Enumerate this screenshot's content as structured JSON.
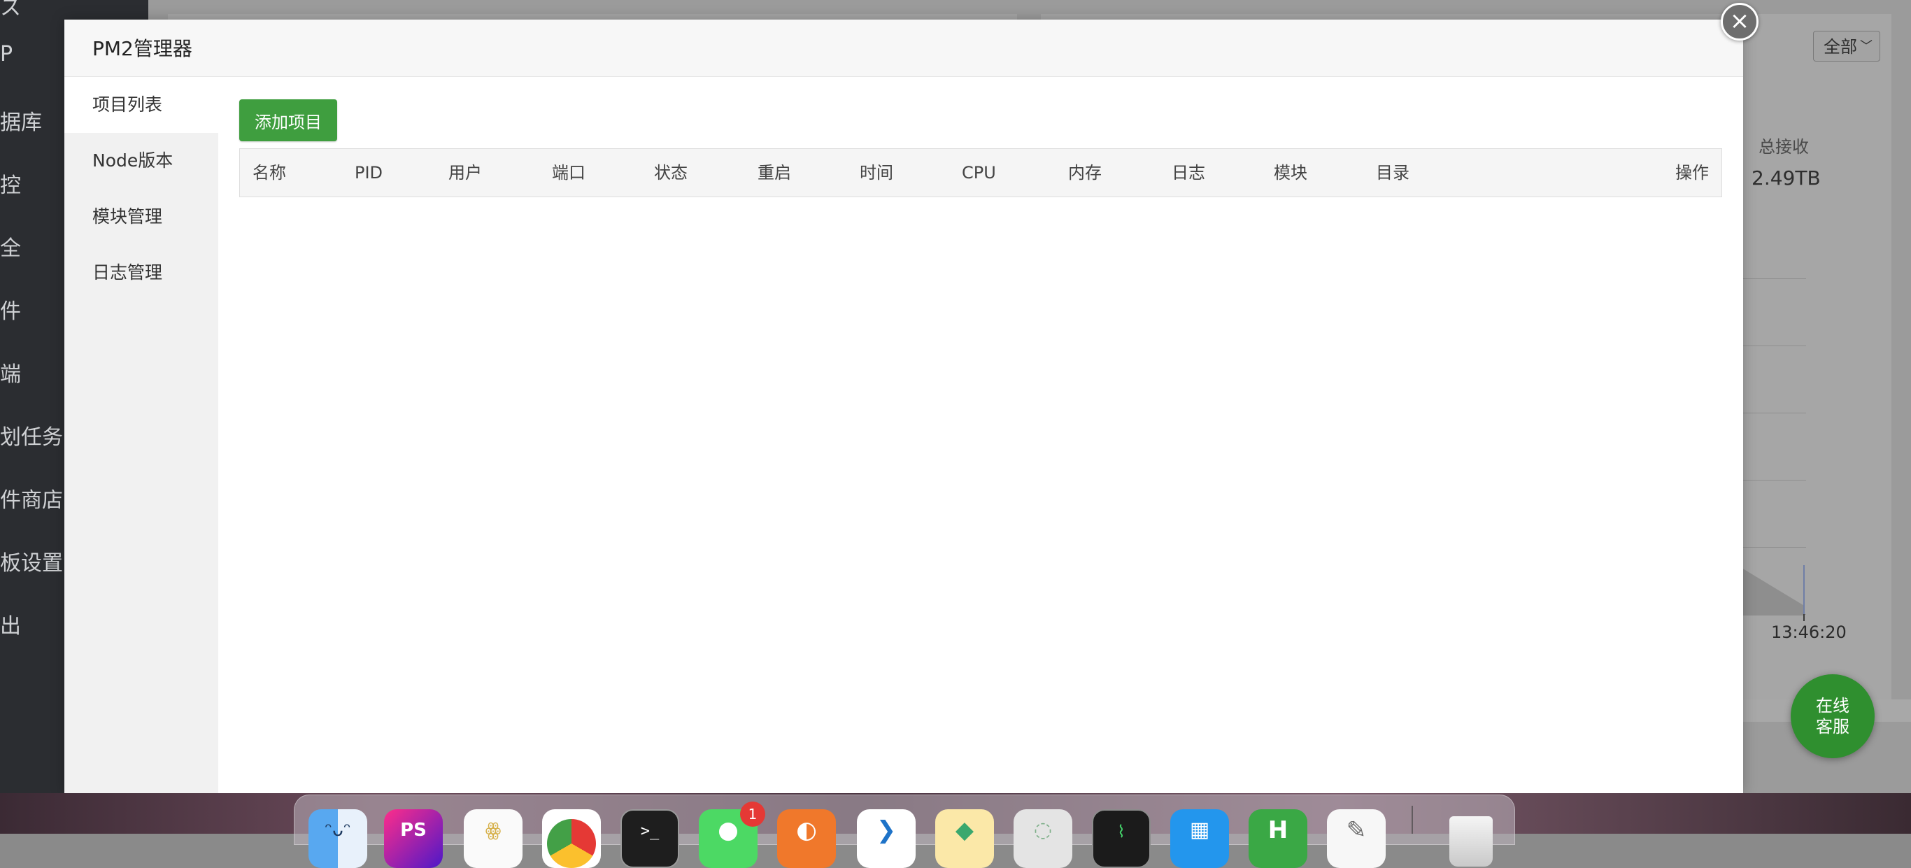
{
  "background": {
    "sidebar_items": [
      "P",
      "据库",
      "控",
      "全",
      "件",
      "端",
      "划任务",
      "件商店",
      "板设置",
      "出"
    ],
    "filter_select": "全部",
    "total_received_label": "总接收",
    "total_received_value": "2.49TB",
    "chart_time_label": "13:46:20"
  },
  "modal": {
    "title": "PM2管理器",
    "tabs": [
      {
        "label": "项目列表",
        "active": true
      },
      {
        "label": "Node版本",
        "active": false
      },
      {
        "label": "模块管理",
        "active": false
      },
      {
        "label": "日志管理",
        "active": false
      }
    ],
    "add_button": "添加项目",
    "columns": [
      "名称",
      "PID",
      "用户",
      "端口",
      "状态",
      "重启",
      "时间",
      "CPU",
      "内存",
      "日志",
      "模块",
      "目录",
      "操作"
    ],
    "rows": []
  },
  "close_icon": "×",
  "service_bubble": {
    "line1": "在线",
    "line2": "客服"
  },
  "dock": {
    "badge_count": "1",
    "icons": [
      "finder-icon",
      "phpstorm-icon",
      "app-icon",
      "chrome-icon",
      "terminal-icon",
      "wechat-icon",
      "app-icon",
      "vscode-icon",
      "app-icon",
      "app-icon",
      "activity-monitor-icon",
      "docker-icon",
      "hbuilder-icon",
      "textedit-icon",
      "trash-icon"
    ],
    "icon_labels": {
      "phpstorm": "PS",
      "terminal": ">_",
      "hbuilder": "H"
    }
  },
  "colors": {
    "primary_button": "#3f9e3f",
    "service_bubble": "#2f8f2f",
    "badge": "#e53935"
  }
}
